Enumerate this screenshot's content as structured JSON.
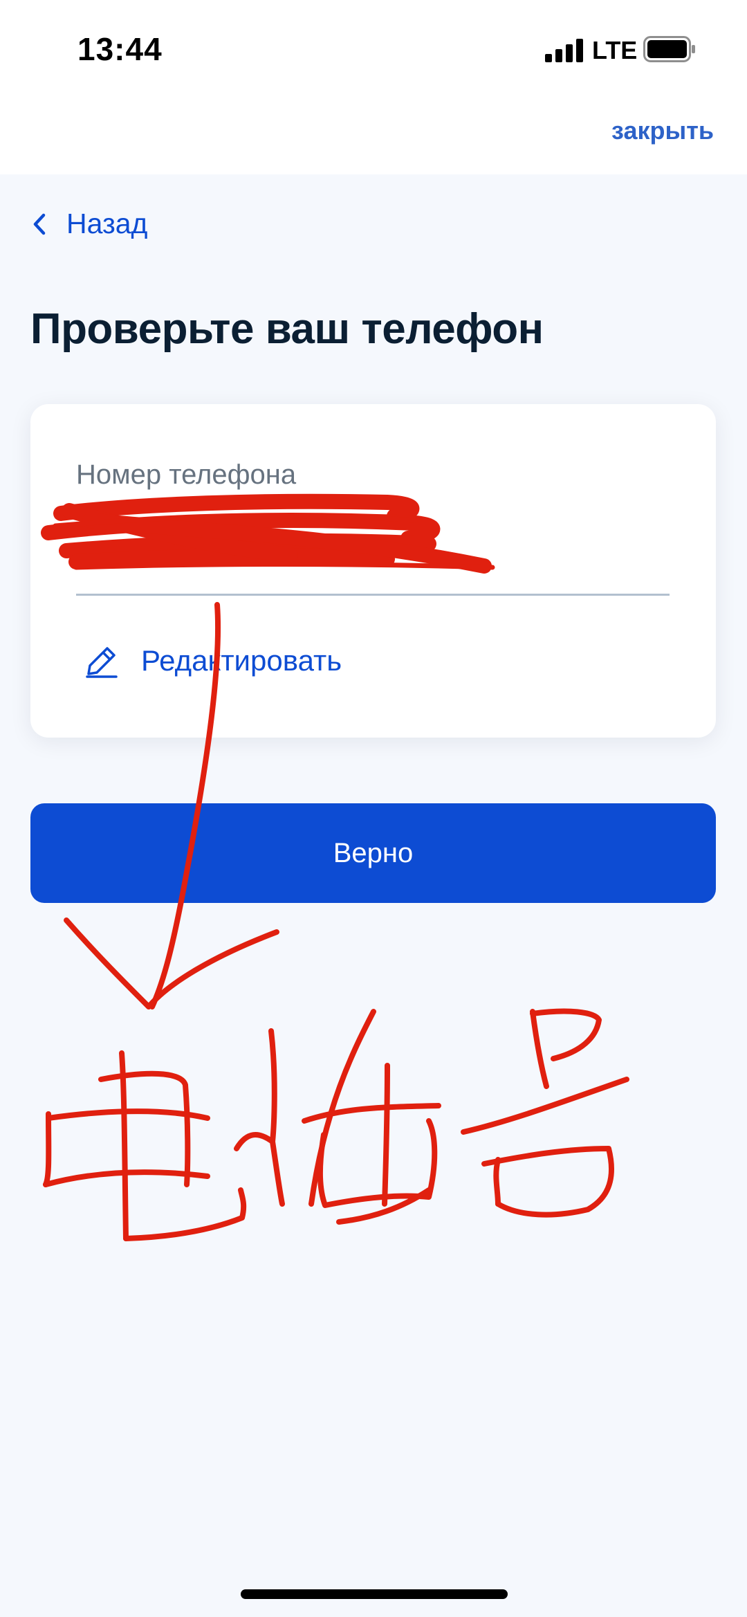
{
  "status_bar": {
    "time": "13:44",
    "network": "LTE",
    "signal_icon": "cellular-signal-icon",
    "battery_icon": "battery-full-icon"
  },
  "header": {
    "close_label": "закрыть"
  },
  "navigation": {
    "back_label": "Назад",
    "back_icon": "chevron-left-icon"
  },
  "page": {
    "title": "Проверьте ваш телефон"
  },
  "phone_card": {
    "field_label": "Номер телефона",
    "field_value": "",
    "edit_label": "Редактировать",
    "edit_icon": "pencil-icon"
  },
  "actions": {
    "confirm_label": "Верно"
  },
  "annotation": {
    "handwritten_text": "电话号",
    "stroke_color": "#e0200f",
    "description_icon": "arrow-down-icon"
  },
  "colors": {
    "accent": "#0d4cd3",
    "background": "#f5f8fd",
    "title": "#0b1f33",
    "muted": "#66727f"
  }
}
